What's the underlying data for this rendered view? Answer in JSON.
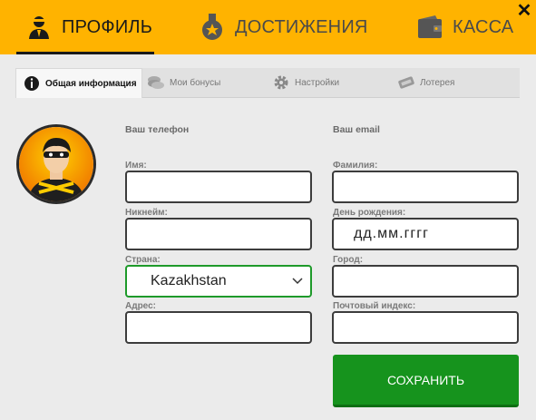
{
  "header": {
    "tabs": [
      {
        "label": "ПРОФИЛЬ",
        "icon": "user-icon"
      },
      {
        "label": "ДОСТИЖЕНИЯ",
        "icon": "medal-icon"
      },
      {
        "label": "КАССА",
        "icon": "wallet-icon"
      }
    ],
    "close_label": "✕"
  },
  "subtabs": [
    {
      "label": "Общая информация",
      "icon": "info-icon"
    },
    {
      "label": "Мои бонусы",
      "icon": "chips-icon"
    },
    {
      "label": "Настройки",
      "icon": "gear-icon"
    },
    {
      "label": "Лотерея",
      "icon": "ticket-icon"
    }
  ],
  "form": {
    "phone_label": "Ваш телефон",
    "email_label": "Ваш email",
    "name_label": "Имя:",
    "name_value": "",
    "surname_label": "Фамилия:",
    "surname_value": "",
    "nickname_label": "Никнейм:",
    "nickname_value": "",
    "birthday_label": "День рождения:",
    "birthday_placeholder": "дд.мм.гггг",
    "country_label": "Страна:",
    "country_value": "Kazakhstan",
    "city_label": "Город:",
    "city_value": "",
    "address_label": "Адрес:",
    "address_value": "",
    "zip_label": "Почтовый индекс:",
    "zip_value": "",
    "save_label": "СОХРАНИТЬ"
  },
  "colors": {
    "header": "#ffb300",
    "save": "#16931d",
    "select_border": "#1e9a2a"
  }
}
